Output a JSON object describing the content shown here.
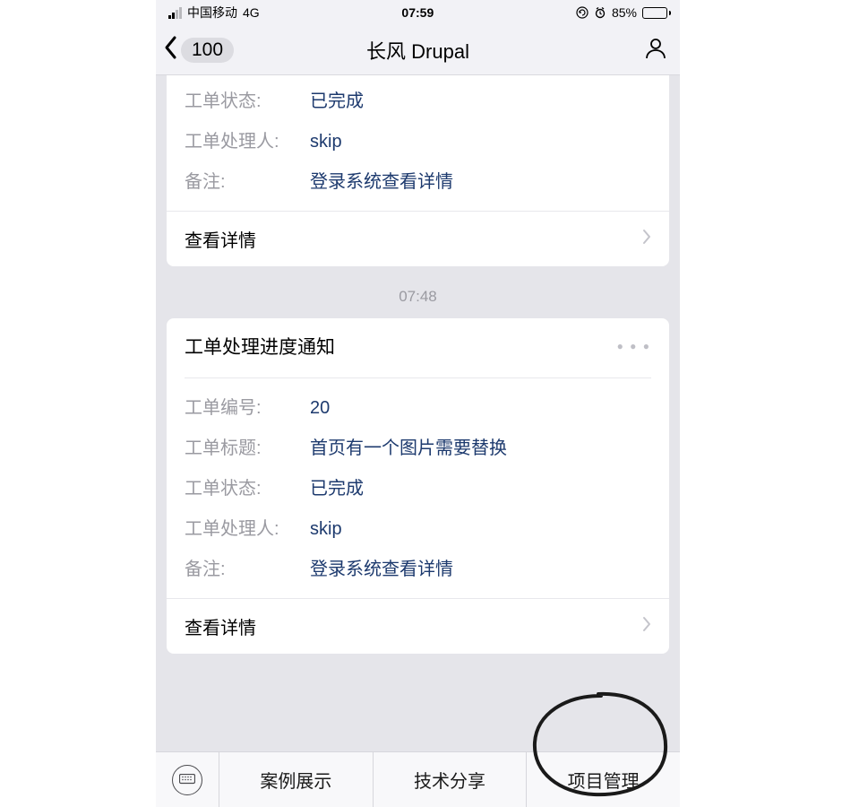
{
  "status": {
    "carrier": "中国移动",
    "network": "4G",
    "time": "07:59",
    "battery_pct": "85%"
  },
  "nav": {
    "unread_count": "100",
    "title": "长风 Drupal"
  },
  "messages": [
    {
      "partial_top": true,
      "rows": [
        {
          "label": "工单状态:",
          "value": "已完成"
        },
        {
          "label": "工单处理人:",
          "value": "skip"
        },
        {
          "label": "备注:",
          "value": "登录系统查看详情"
        }
      ],
      "footer_label": "查看详情"
    }
  ],
  "timestamp_between": "07:48",
  "second_card": {
    "title": "工单处理进度通知",
    "rows": [
      {
        "label": "工单编号:",
        "value": "20"
      },
      {
        "label": "工单标题:",
        "value": "首页有一个图片需要替换"
      },
      {
        "label": "工单状态:",
        "value": "已完成"
      },
      {
        "label": "工单处理人:",
        "value": "skip"
      },
      {
        "label": "备注:",
        "value": "登录系统查看详情"
      }
    ],
    "footer_label": "查看详情"
  },
  "bottom_menu": {
    "tabs": [
      {
        "label": "案例展示"
      },
      {
        "label": "技术分享"
      },
      {
        "label": "项目管理"
      }
    ]
  }
}
